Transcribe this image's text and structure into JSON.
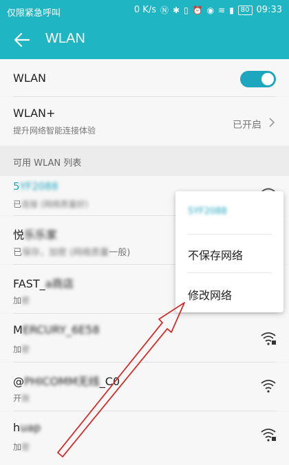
{
  "status_bar": {
    "carrier": "仅限紧急呼叫",
    "speed": "0 K/s",
    "battery": "80",
    "time": "09:33"
  },
  "app_bar": {
    "title": "WLAN"
  },
  "wlan_row": {
    "label": "WLAN",
    "enabled": true
  },
  "wlan_plus": {
    "label": "WLAN+",
    "description": "提升网络智能连接体验",
    "status": "已开启"
  },
  "section_header": "可用 WLAN 列表",
  "networks": [
    {
      "ssid": "5",
      "status": "已"
    },
    {
      "ssid": "悦",
      "status": "已",
      "status_tail": "一般)"
    },
    {
      "ssid": "FAST_",
      "status": "加"
    },
    {
      "ssid": "M",
      "status": "加"
    },
    {
      "ssid": "@",
      "ssid_tail": "_C0",
      "status": "开"
    },
    {
      "ssid": "h",
      "status": "加"
    }
  ],
  "popup": {
    "ssid": "5",
    "items": [
      "不保存网络",
      "修改网络"
    ]
  },
  "colors": {
    "accent": "#1fb5c2",
    "toggle": "#1fa6bf",
    "arrow": "#d52b2b"
  }
}
